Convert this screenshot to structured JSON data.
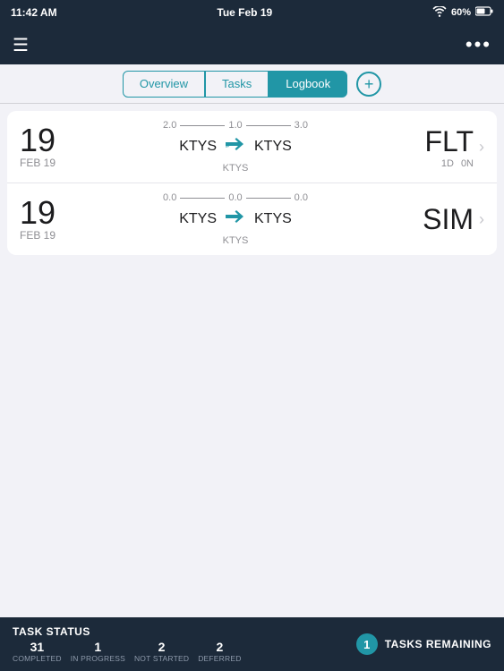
{
  "statusBar": {
    "time": "11:42 AM",
    "date": "Tue Feb 19",
    "wifi": "wifi",
    "battery": "60%"
  },
  "navBar": {
    "menuIcon": "☰",
    "moreIcon": "•••"
  },
  "tabs": [
    {
      "id": "overview",
      "label": "Overview",
      "active": false
    },
    {
      "id": "tasks",
      "label": "Tasks",
      "active": false
    },
    {
      "id": "logbook",
      "label": "Logbook",
      "active": true
    }
  ],
  "addButton": "+",
  "flights": [
    {
      "dateDay": "19",
      "dateMonth": "FEB 19",
      "routeNumLeft": "2.0",
      "routeNumMid": "1.0",
      "routeNumRight": "3.0",
      "fromAirport": "KTYS",
      "toAirport": "KTYS",
      "subAirport": "KTYS",
      "type": "FLT",
      "metaLeft": "1D",
      "metaRight": "0N"
    },
    {
      "dateDay": "19",
      "dateMonth": "FEB 19",
      "routeNumLeft": "0.0",
      "routeNumMid": "0.0",
      "routeNumRight": "0.0",
      "fromAirport": "KTYS",
      "toAirport": "KTYS",
      "subAirport": "KTYS",
      "type": "SIM",
      "metaLeft": "",
      "metaRight": ""
    }
  ],
  "taskBar": {
    "statusLabel": "TASK STATUS",
    "counts": [
      {
        "num": "31",
        "sub": "COMPLETED"
      },
      {
        "num": "1",
        "sub": "IN PROGRESS"
      },
      {
        "num": "2",
        "sub": "NOT STARTED"
      },
      {
        "num": "2",
        "sub": "DEFERRED"
      }
    ],
    "remainingBadge": "1",
    "remainingLabel": "TASKS REMAINING"
  }
}
